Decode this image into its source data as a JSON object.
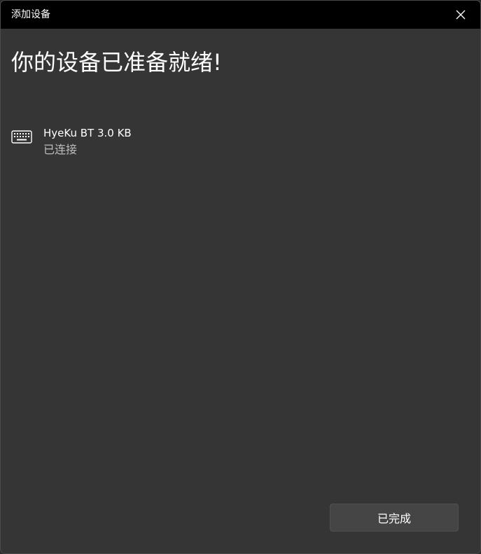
{
  "window": {
    "title": "添加设备"
  },
  "main": {
    "heading": "你的设备已准备就绪!"
  },
  "device": {
    "name": "HyeKu BT 3.0 KB",
    "status": "已连接",
    "icon": "keyboard-icon"
  },
  "footer": {
    "done_label": "已完成"
  },
  "colors": {
    "titlebar": "#000000",
    "background": "#353535",
    "button": "#454545",
    "secondary_text": "#bdbdbd"
  }
}
